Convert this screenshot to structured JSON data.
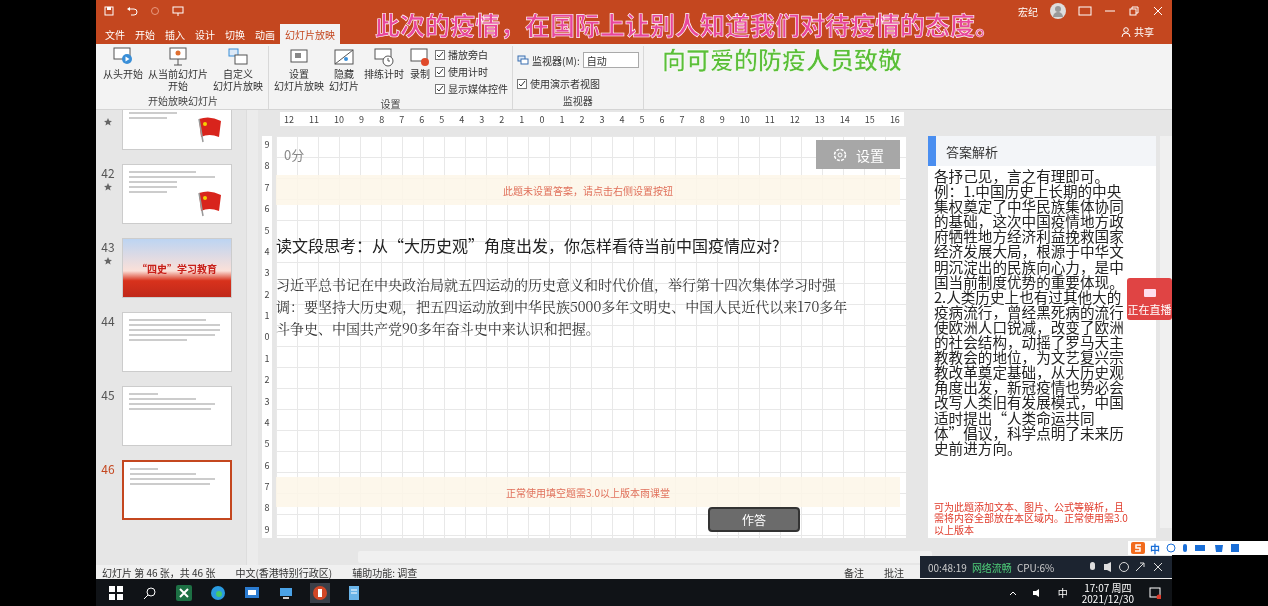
{
  "title_bar": {
    "user": "宏纪"
  },
  "overlay_captions": [
    {
      "text": "此次的疫情，在国际上让别人知道我们对待疫情的态度。",
      "color": "#e8479c"
    },
    {
      "text": "向可爱的防疫人员致敬",
      "color": "#5cbf3a"
    }
  ],
  "tabs": [
    {
      "label": "文件",
      "selected": false
    },
    {
      "label": "开始",
      "selected": false
    },
    {
      "label": "插入",
      "selected": false
    },
    {
      "label": "设计",
      "selected": false
    },
    {
      "label": "切换",
      "selected": false
    },
    {
      "label": "动画",
      "selected": false
    },
    {
      "label": "幻灯片放映",
      "selected": true
    }
  ],
  "share": "共享",
  "ribbon_groups": [
    {
      "label": "开始放映幻灯片",
      "items": [
        {
          "kind": "big",
          "lines": [
            "从头开始"
          ]
        },
        {
          "kind": "big",
          "lines": [
            "从当前幻灯片",
            "开始"
          ]
        },
        {
          "kind": "big",
          "lines": [
            "自定义",
            "幻灯片放映"
          ]
        }
      ]
    },
    {
      "label": "设置",
      "items": [
        {
          "kind": "big",
          "lines": [
            "设置",
            "幻灯片放映"
          ]
        },
        {
          "kind": "big",
          "lines": [
            "隐藏",
            "幻灯片"
          ]
        },
        {
          "kind": "big",
          "lines": [
            "排练计时"
          ]
        },
        {
          "kind": "big",
          "lines": [
            "录制"
          ]
        },
        {
          "kind": "checks",
          "checks": [
            {
              "label": "播放旁白",
              "checked": true
            },
            {
              "label": "使用计时",
              "checked": true
            },
            {
              "label": "显示媒体控件",
              "checked": true
            }
          ]
        }
      ]
    },
    {
      "label": "监视器",
      "items": [
        {
          "kind": "monitor",
          "label": "监视器(M):",
          "value": "自动",
          "checks": [
            {
              "label": "使用演示者视图",
              "checked": true
            }
          ]
        }
      ]
    }
  ],
  "slides": [
    {
      "starred": true,
      "selected": false,
      "kind": "flag"
    },
    {
      "number": "42",
      "starred": true,
      "selected": false,
      "kind": "flag"
    },
    {
      "number": "43",
      "starred": true,
      "selected": false,
      "kind": "banner",
      "caption": "“四史”学习教育"
    },
    {
      "number": "44",
      "starred": false,
      "selected": false,
      "kind": "text"
    },
    {
      "number": "45",
      "starred": false,
      "selected": false,
      "kind": "quiz"
    },
    {
      "number": "46",
      "starred": false,
      "selected": true,
      "kind": "quiz"
    }
  ],
  "ruler": {
    "horizontal": [
      "12",
      "11",
      "10",
      "9",
      "8",
      "7",
      "6",
      "5",
      "4",
      "3",
      "2",
      "1",
      "0",
      "1",
      "2",
      "3",
      "4",
      "5",
      "6",
      "7",
      "8",
      "9",
      "10",
      "11",
      "12",
      "13",
      "14",
      "15",
      "16"
    ],
    "vertical": [
      "9",
      "8",
      "7",
      "6",
      "5",
      "4",
      "3",
      "2",
      "1",
      "0",
      "1",
      "2",
      "3",
      "4",
      "5",
      "6",
      "7",
      "8",
      "9"
    ]
  },
  "slide": {
    "score": "0分",
    "settings_button": "设置",
    "hint_top": "此题未设置答案，请点击右侧设置按钮",
    "question": "读文段思考：从“大历史观”角度出发，你怎样看待当前中国疫情应对?",
    "passage": "习近平总书记在中央政治局就五四运动的历史意义和时代价值，举行第十四次集体学习时强调：要坚持大历史观，把五四运动放到中华民族5000多年文明史、中国人民近代以来170多年斗争史、中国共产党90多年奋斗史中来认识和把握。",
    "hint_bottom": "正常使用填空题需3.0以上版本雨课堂",
    "answer_button": "作答"
  },
  "answer_panel": {
    "title": "答案解析",
    "paragraphs": [
      "各抒己见，言之有理即可。",
      "例：1.中国历史上长期的中央集权奠定了中华民族集体协同的基础，这次中国疫情地方政府牺牲地方经济利益挽救国家经济发展大局，根源于中华文明沉淀出的民族向心力，是中国当前制度优势的重要体现。",
      "2.人类历史上也有过其他大的疫病流行，曾经黑死病的流行使欧洲人口锐减，改变了欧洲的社会结构，动摇了罗马天主教教会的地位，为文艺复兴宗教改革奠定基础，从大历史观角度出发，新冠疫情也势必会改写人类旧有发展模式，中国适时提出“人类命运共同体”倡议，科学点明了未来历史前进方向。"
    ],
    "footer": "可为此题添加文本、图片、公式等解析，且需将内容全部放在本区域内。正常使用需3.0以上版本"
  },
  "live_badge": "正在直播",
  "status_bar": {
    "slide_info": "幻灯片 第 46 张，共 46 张",
    "language": "中文(香港特别行政区)",
    "accessibility": "辅助功能: 调查",
    "notes": "备注",
    "comments": "批注"
  },
  "stream_widget": {
    "duration": "00:48:19",
    "network": "网络流畅",
    "cpu": "CPU:6%"
  },
  "ime": {
    "mode": "中"
  },
  "taskbar": {
    "ime": "中",
    "time": "17:07 周四",
    "date": "2021/12/30"
  }
}
